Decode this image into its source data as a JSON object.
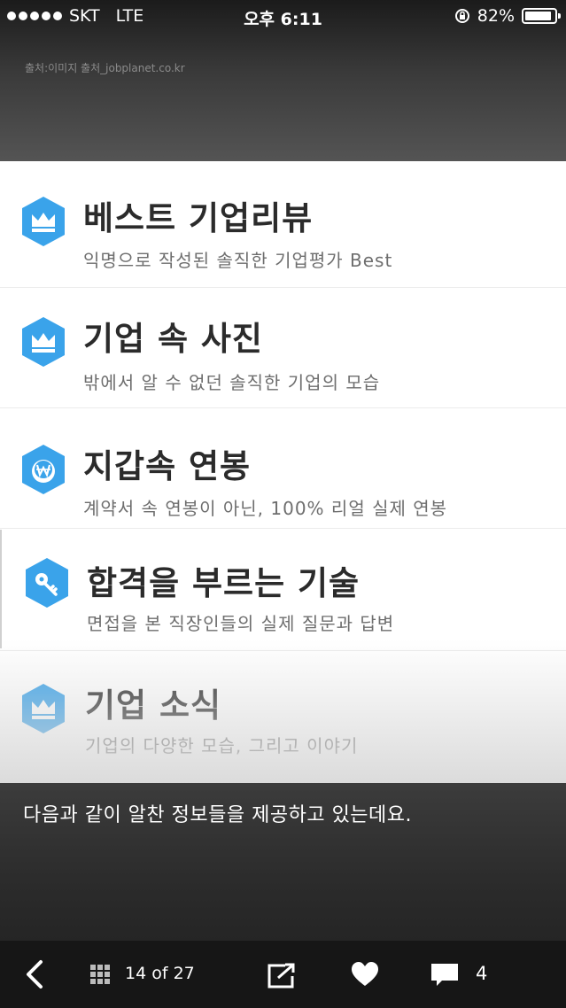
{
  "status_bar": {
    "carrier": "SKT",
    "network": "LTE",
    "time": "오후 6:11",
    "battery": "82%"
  },
  "source_note": "출처:이미지 출처_jobplanet.co.kr",
  "items": [
    {
      "title": "베스트 기업리뷰",
      "desc": "익명으로 작성된 솔직한 기업평가 Best",
      "icon": "crown-icon"
    },
    {
      "title": "기업 속 사진",
      "desc": "밖에서 알 수 없던 솔직한 기업의 모습",
      "icon": "crown-icon"
    },
    {
      "title": "지갑속 연봉",
      "desc": "계약서 속 연봉이 아닌, 100% 리얼 실제 연봉",
      "icon": "won-coin-icon"
    },
    {
      "title": "합격을 부르는 기술",
      "desc": "면접을 본 직장인들의 실제 질문과 답변",
      "icon": "key-icon"
    },
    {
      "title": "기업 소식",
      "desc": "기업의 다양한 모습, 그리고 이야기",
      "icon": "crown-icon"
    }
  ],
  "caption": "다음과 같이 알찬 정보들을 제공하고 있는데요.",
  "toolbar": {
    "page_indicator": "14 of 27",
    "comment_count": "4"
  },
  "colors": {
    "accent_blue": "#3aa3ea",
    "title_text": "#2b2b2b",
    "desc_text": "#6e6e6e"
  }
}
